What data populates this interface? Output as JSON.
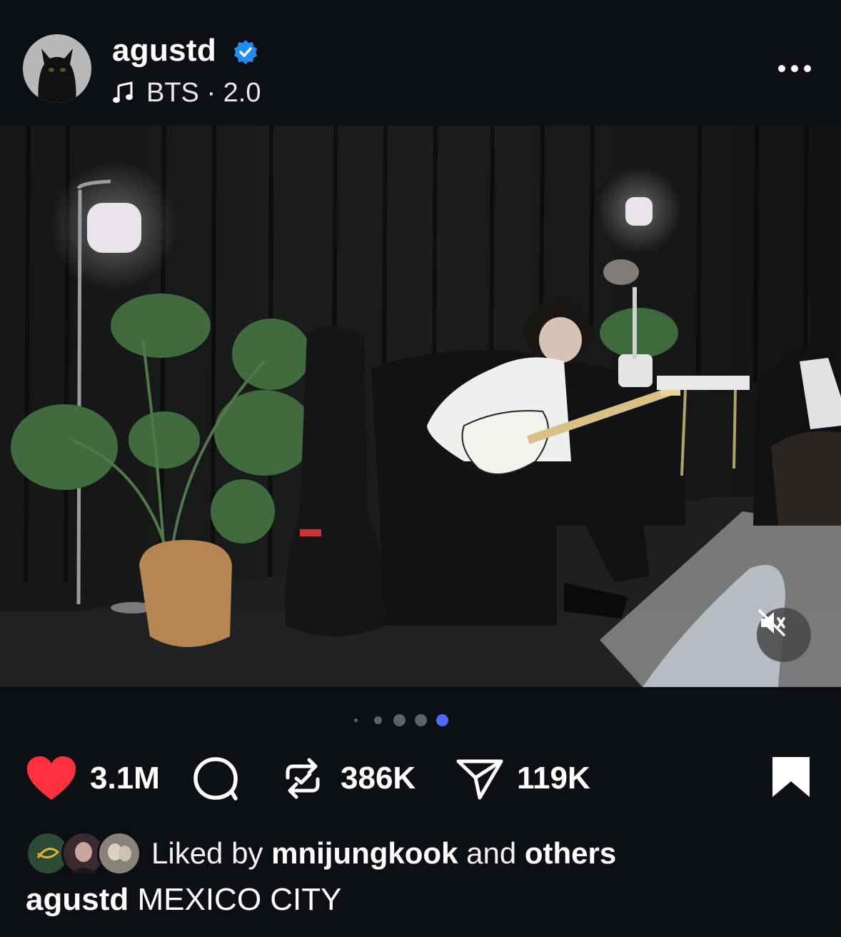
{
  "post": {
    "username": "agustd",
    "verified": true,
    "music_icon": "music-note-icon",
    "music_text": "BTS · 2.0",
    "more_icon": "more-horizontal-icon"
  },
  "carousel": {
    "total": 5,
    "active_index": 4
  },
  "actions": {
    "likes": "3.1M",
    "comments_icon": "comment-icon",
    "reposts": "386K",
    "shares": "119K",
    "bookmark_icon": "bookmark-icon",
    "liked": true
  },
  "liked_by": {
    "prefix": "Liked by",
    "user": "mnijungkook",
    "middle": "and",
    "others": "others"
  },
  "caption": {
    "username": "agustd",
    "text": "MEXICO CITY"
  },
  "colors": {
    "background": "#0c1015",
    "like_red": "#ff3040",
    "verified_blue": "#1f8ef1",
    "active_dot": "#4f6bf5",
    "inactive_dot": "#5f6368"
  }
}
